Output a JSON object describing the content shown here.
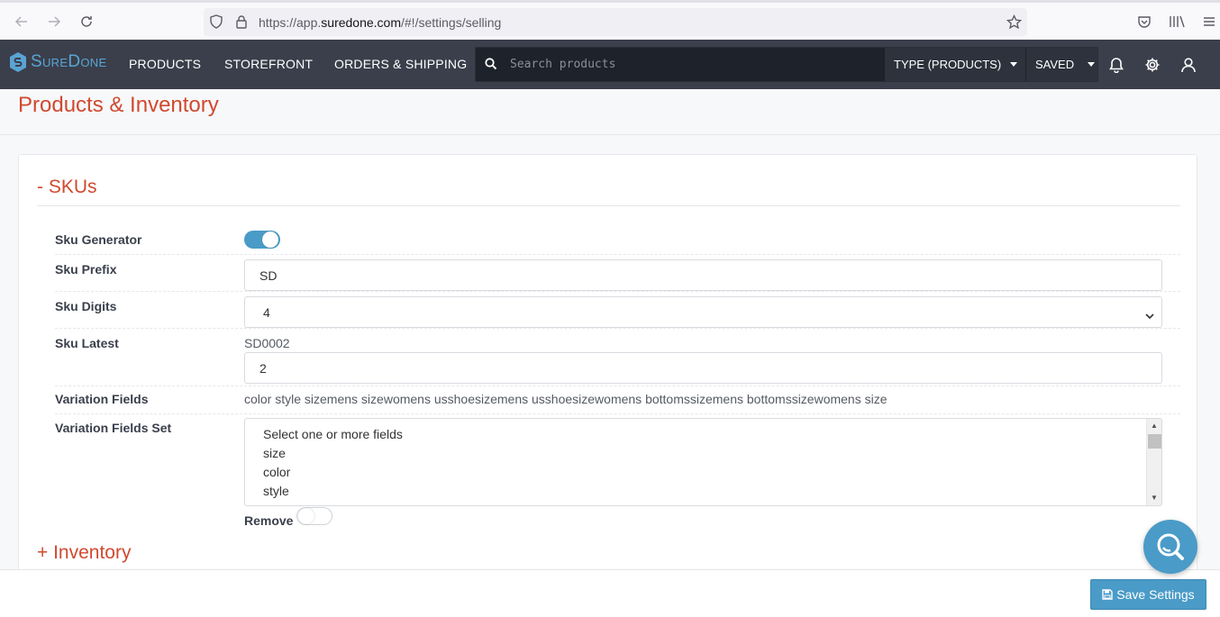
{
  "browser": {
    "url_prefix": "https://app.",
    "url_host": "suredone.com",
    "url_path": "/#!/settings/selling"
  },
  "nav": {
    "logo_text": "SureDone",
    "links": [
      "PRODUCTS",
      "STOREFRONT",
      "ORDERS & SHIPPING"
    ],
    "search_placeholder": "Search products",
    "type_dropdown": "TYPE (PRODUCTS)",
    "saved_dropdown": "SAVED",
    "icons": [
      "bell-icon",
      "gear-icon",
      "user-icon"
    ]
  },
  "page": {
    "title": "Products & Inventory"
  },
  "skus": {
    "heading": "- SKUs",
    "sku_generator": {
      "label": "Sku Generator",
      "enabled": true
    },
    "sku_prefix": {
      "label": "Sku Prefix",
      "value": "SD"
    },
    "sku_digits": {
      "label": "Sku Digits",
      "value": "4"
    },
    "sku_latest": {
      "label": "Sku Latest",
      "display": "SD0002",
      "value": "2"
    },
    "variation_fields": {
      "label": "Variation Fields",
      "value": "color style sizemens sizewomens usshoesizemens usshoesizewomens bottomssizemens bottomssizewomens size"
    },
    "variation_fields_set": {
      "label": "Variation Fields Set",
      "options": [
        "Select one or more fields",
        "size",
        "color",
        "style"
      ],
      "remove_label": "Remove",
      "remove_enabled": false
    }
  },
  "inventory": {
    "heading": "+ Inventory"
  },
  "footer": {
    "save_label": "Save Settings"
  },
  "colors": {
    "accent": "#d04a2f",
    "primary": "#4a9bc8",
    "nav_bg": "#3a3f4b"
  }
}
